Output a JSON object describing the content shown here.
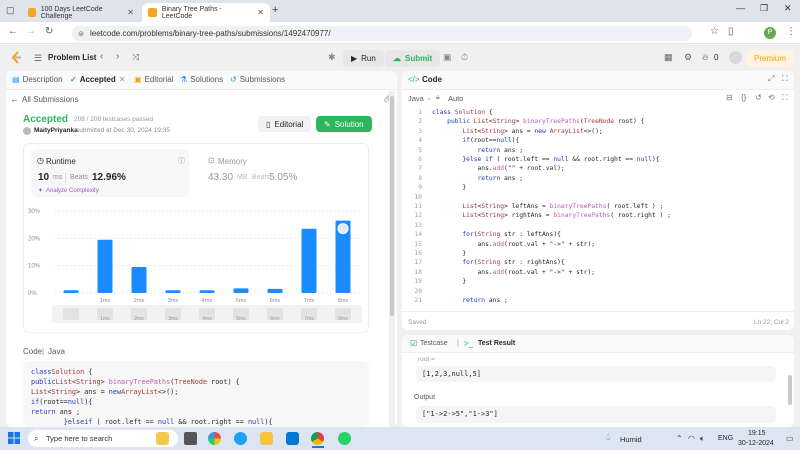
{
  "browser": {
    "tabs": [
      {
        "label": "100 Days LeetCode Challenge"
      },
      {
        "label": "Binary Tree Paths - LeetCode"
      }
    ],
    "url": "leetcode.com/problems/binary-tree-paths/submissions/1492470977/"
  },
  "nav": {
    "problem_list": "Problem List",
    "run": "Run",
    "submit": "Submit",
    "fire_count": "0",
    "premium": "Premium"
  },
  "left": {
    "tabs": [
      "Description",
      "Accepted",
      "Editorial",
      "Solutions",
      "Submissions"
    ],
    "all_submissions": "All Submissions",
    "status": "Accepted",
    "testcases": "208 / 208 testcases passed",
    "author": "MaityPriyanka",
    "submitted": "submitted at Dec 30, 2024 19:35",
    "editorial_btn": "Editorial",
    "solution_btn": "Solution",
    "runtime_label": "Runtime",
    "runtime_value": "10",
    "runtime_unit": "ms",
    "beats_label": "Beats",
    "beats_value": "12.96%",
    "analyze": "Analyze Complexity",
    "memory_label": "Memory",
    "memory_value": "43.30",
    "memory_unit": "MB",
    "memory_beats_label": "Beats",
    "memory_beats": "5.05%",
    "code_label": "Code",
    "code_lang": "Java",
    "code_lines": [
      "class Solution {",
      "    public List<String> binaryTreePaths(TreeNode root) {",
      "        List<String> ans = new ArrayList<>();",
      "        if(root==null){",
      "            return ans ;",
      "        }else if ( root.left == null && root.right == null){"
    ]
  },
  "chart_data": {
    "type": "bar",
    "categories": [
      "",
      "1ms",
      "2ms",
      "3ms",
      "4ms",
      "5ms",
      "6ms",
      "7ms",
      "8ms"
    ],
    "values": [
      1,
      19.5,
      9.5,
      1,
      1,
      1.7,
      1.5,
      23.5,
      26.5
    ],
    "ylim": [
      0,
      30
    ],
    "yticks": [
      "30%",
      "20%",
      "10%",
      "0%"
    ],
    "highlight_index": 8,
    "colors": {
      "bar": "#1a8cff"
    },
    "minimap_labels": [
      "",
      "1ms",
      "2ms",
      "3ms",
      "4ms",
      "5ms",
      "6ms",
      "7ms",
      "8ms"
    ]
  },
  "editor": {
    "title": "Code",
    "lang": "Java",
    "mode": "Auto",
    "saved": "Saved",
    "cursor": "Ln 22, Col 2",
    "lines": [
      "class Solution {",
      "    public List<String> binaryTreePaths(TreeNode root) {",
      "        List<String> ans = new ArrayList<>();",
      "        if(root==null){",
      "            return ans ;",
      "        }else if ( root.left == null && root.right == null){",
      "            ans.add(\"\" + root.val);",
      "            return ans ;",
      "        }",
      "",
      "        List<String> leftAns = binaryTreePaths( root.left ) ;",
      "        List<String> rightAns = binaryTreePaths( root.right ) ;",
      "",
      "        for(String str : leftAns){",
      "            ans.add(root.val + \"->\" + str);",
      "        }",
      "        for(String str : rightAns){",
      "            ans.add(root.val + \"->\" + str);",
      "        }",
      "",
      "        return ans ;"
    ]
  },
  "test": {
    "testcase_tab": "Testcase",
    "result_tab": "Test Result",
    "input_label": "root =",
    "input_value": "[1,2,3,null,5]",
    "output_label": "Output",
    "output_value": "[\"1->2->5\",\"1->3\"]"
  },
  "taskbar": {
    "search": "Type here to search",
    "weather": "Humid",
    "lang": "ENG",
    "time": "19:15",
    "date": "30-12-2024"
  }
}
